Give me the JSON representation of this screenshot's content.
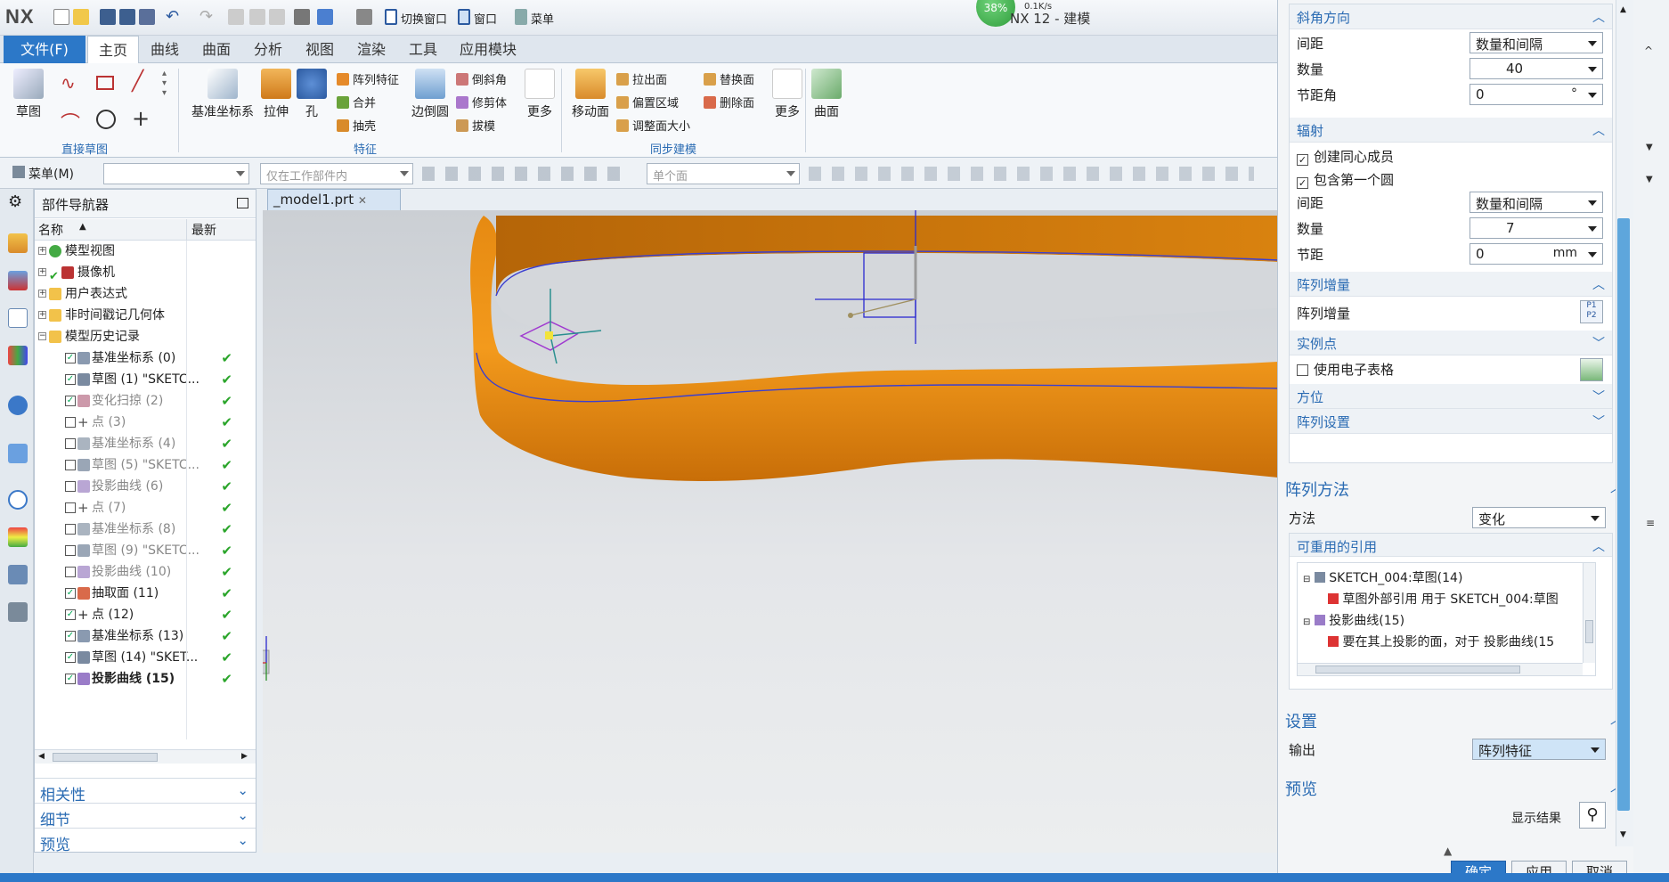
{
  "app": {
    "logo": "NX",
    "title": "NX 12 - 建模",
    "speed_percent": "38%",
    "speed_rate": "0.1K/s"
  },
  "quick_access": {
    "switch_window": "切换窗口",
    "window": "窗口",
    "menu": "菜单"
  },
  "tabs": [
    {
      "label": "文件(F)"
    },
    {
      "label": "主页"
    },
    {
      "label": "曲线"
    },
    {
      "label": "曲面"
    },
    {
      "label": "分析"
    },
    {
      "label": "视图"
    },
    {
      "label": "渲染"
    },
    {
      "label": "工具"
    },
    {
      "label": "应用模块"
    }
  ],
  "ribbon": {
    "sketch": "草图",
    "direct_sketch_group": "直接草图",
    "datum_csys": "基准坐标系",
    "extrude": "拉伸",
    "hole": "孔",
    "pattern_feature": "阵列特征",
    "unite": "合并",
    "shell": "抽壳",
    "edge_blend": "边倒圆",
    "chamfer": "倒斜角",
    "trim_body": "修剪体",
    "draft": "拔模",
    "more1": "更多",
    "feature_group": "特征",
    "move_face": "移动面",
    "pull_face": "拉出面",
    "offset_region": "偏置区域",
    "resize_face": "调整面大小",
    "replace_face": "替换面",
    "delete_face": "删除面",
    "more2": "更多",
    "sync_group": "同步建模",
    "surface": "曲面"
  },
  "selection_bar": {
    "menu": "菜单(M)",
    "filter": "",
    "scope": "仅在工作部件内",
    "face_rule": "单个面"
  },
  "navigator": {
    "title": "部件导航器",
    "col_name": "名称",
    "col_latest": "最新",
    "nodes": [
      {
        "label": "模型视图"
      },
      {
        "label": "摄像机"
      },
      {
        "label": "用户表达式"
      },
      {
        "label": "非时间戳记几何体"
      },
      {
        "label": "模型历史记录"
      },
      {
        "label": "基准坐标系 (0)",
        "check": "✔"
      },
      {
        "label": "草图 (1) \"SKETC...",
        "check": "✔"
      },
      {
        "label": "变化扫掠 (2)",
        "check": "✔"
      },
      {
        "label": "点 (3)",
        "check": "✔"
      },
      {
        "label": "基准坐标系 (4)",
        "check": "✔"
      },
      {
        "label": "草图 (5) \"SKETC...",
        "check": "✔"
      },
      {
        "label": "投影曲线 (6)",
        "check": "✔"
      },
      {
        "label": "点 (7)",
        "check": "✔"
      },
      {
        "label": "基准坐标系 (8)",
        "check": "✔"
      },
      {
        "label": "草图 (9) \"SKETC...",
        "check": "✔"
      },
      {
        "label": "投影曲线 (10)",
        "check": "✔"
      },
      {
        "label": "抽取面 (11)",
        "check": "✔"
      },
      {
        "label": "点 (12)",
        "check": "✔"
      },
      {
        "label": "基准坐标系 (13)",
        "check": "✔"
      },
      {
        "label": "草图 (14) \"SKET...",
        "check": "✔"
      },
      {
        "label": "投影曲线 (15)",
        "check": "✔"
      }
    ],
    "sections": [
      {
        "label": "相关性"
      },
      {
        "label": "细节"
      },
      {
        "label": "预览"
      }
    ]
  },
  "document_tab": "_model1.prt",
  "dialog": {
    "chamfer_dir": {
      "title": "斜角方向",
      "spacing_label": "间距",
      "spacing_value": "数量和间隔",
      "count_label": "数量",
      "count_value": "40",
      "pitch_label": "节距角",
      "pitch_value": "0",
      "pitch_unit": "°"
    },
    "radial": {
      "title": "辐射",
      "create_concentric": "创建同心成员",
      "include_first": "包含第一个圆",
      "spacing_label": "间距",
      "spacing_value": "数量和间隔",
      "count_label": "数量",
      "count_value": "7",
      "pitch_label": "节距",
      "pitch_value": "0",
      "pitch_unit": "mm"
    },
    "increment": {
      "title": "阵列增量",
      "label": "阵列增量"
    },
    "instance_points": {
      "title": "实例点",
      "spreadsheet": "使用电子表格"
    },
    "orientation": {
      "title": "方位"
    },
    "pattern_settings": {
      "title": "阵列设置"
    },
    "pattern_method": {
      "title": "阵列方法",
      "method_label": "方法",
      "method_value": "变化",
      "reusable_title": "可重用的引用",
      "refs": [
        "SKETCH_004:草图(14)",
        "草图外部引用 用于 SKETCH_004:草图",
        "投影曲线(15)",
        "要在其上投影的面，对于 投影曲线(15"
      ]
    },
    "settings": {
      "title": "设置",
      "output_label": "输出",
      "output_value": "阵列特征"
    },
    "preview": {
      "title": "预览",
      "show_result": "显示结果"
    },
    "buttons": {
      "ok": "确定",
      "apply": "应用",
      "cancel": "取消"
    }
  }
}
